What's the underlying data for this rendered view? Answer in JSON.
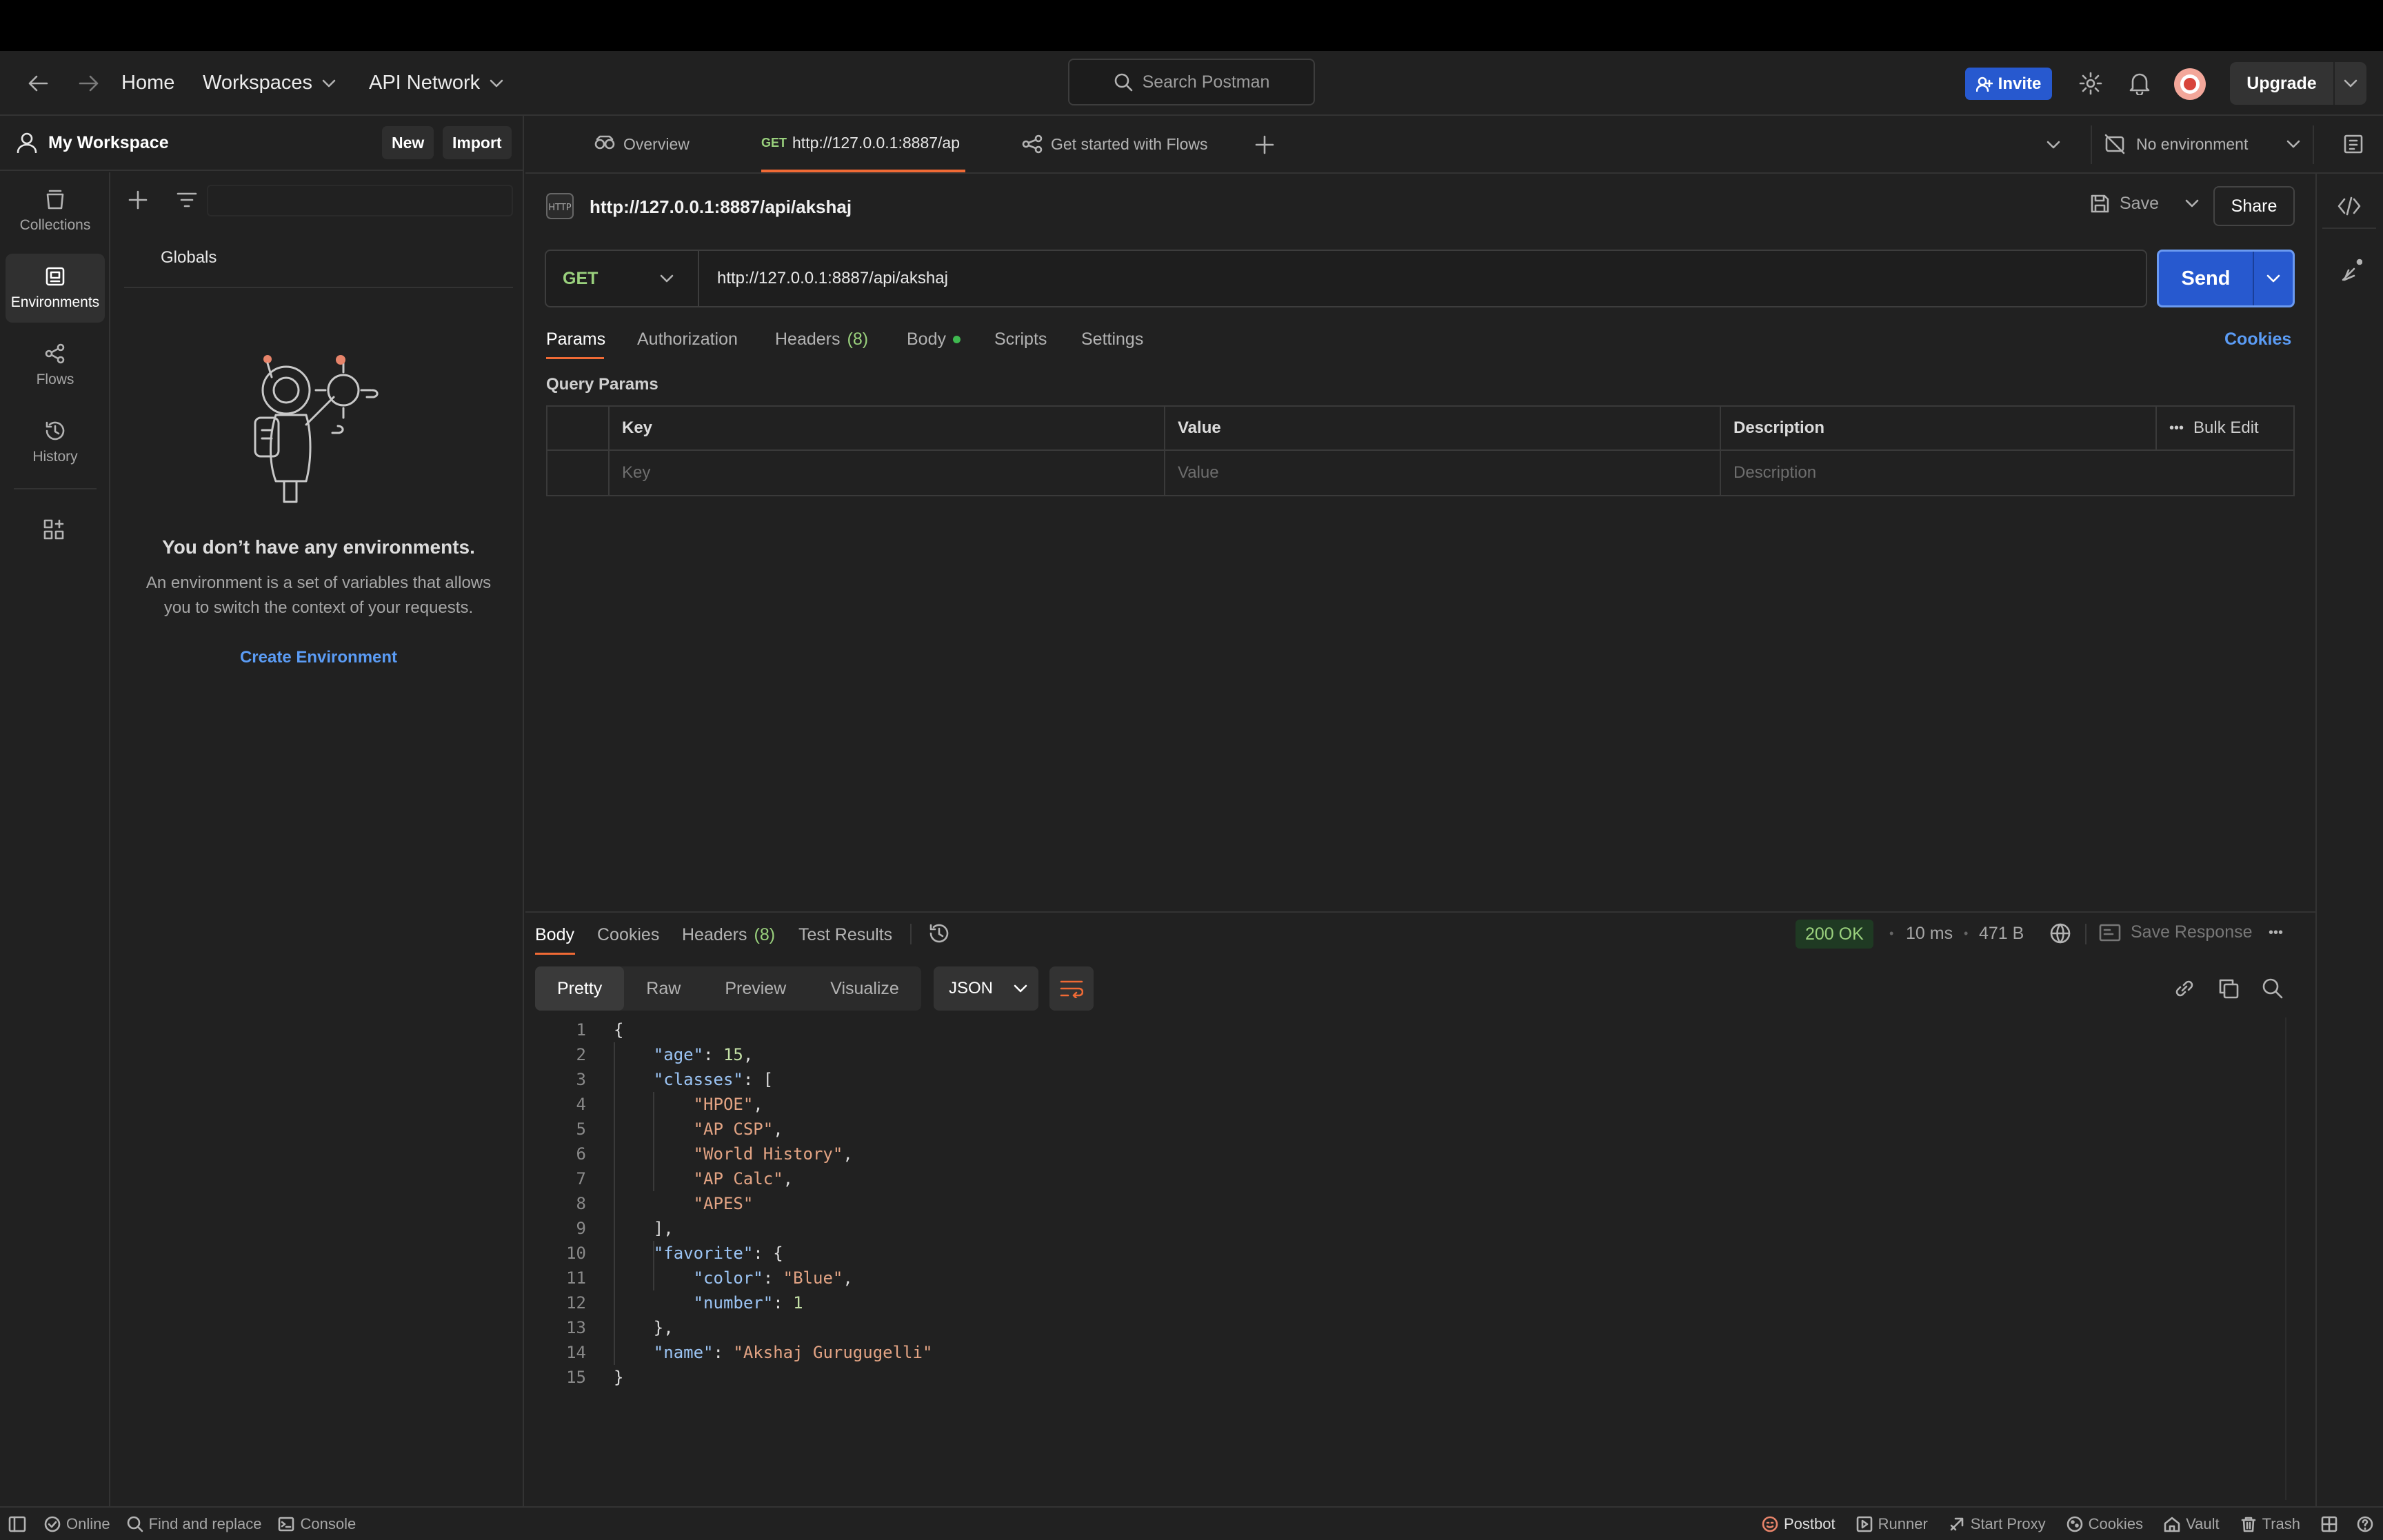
{
  "header": {
    "nav_home": "Home",
    "nav_workspaces": "Workspaces",
    "nav_api_network": "API Network",
    "search_placeholder": "Search Postman",
    "invite_label": "Invite",
    "upgrade_label": "Upgrade"
  },
  "sidebar": {
    "workspace_name": "My Workspace",
    "new_label": "New",
    "import_label": "Import",
    "rail": [
      {
        "label": "Collections",
        "icon": "collections-icon"
      },
      {
        "label": "Environments",
        "icon": "environments-icon"
      },
      {
        "label": "Flows",
        "icon": "flows-icon"
      },
      {
        "label": "History",
        "icon": "history-icon"
      }
    ],
    "globals_label": "Globals",
    "empty_title": "You don’t have any environments.",
    "empty_text_1": "An environment is a set of variables that allows",
    "empty_text_2": "you to switch the context of your requests.",
    "create_link": "Create Environment"
  },
  "tabs": {
    "overview": "Overview",
    "request_method": "GET",
    "request_url": "http://127.0.0.1:8887/ap",
    "flows": "Get started with Flows",
    "environment": "No environment"
  },
  "request": {
    "title": "http://127.0.0.1:8887/api/akshaj",
    "save_label": "Save",
    "share_label": "Share",
    "method": "GET",
    "url": "http://127.0.0.1:8887/api/akshaj",
    "send_label": "Send",
    "subtabs": {
      "params": "Params",
      "authorization": "Authorization",
      "headers": "Headers",
      "headers_count": "(8)",
      "body": "Body",
      "scripts": "Scripts",
      "settings": "Settings"
    },
    "cookies_link": "Cookies",
    "query_params_title": "Query Params",
    "columns": {
      "key": "Key",
      "value": "Value",
      "description": "Description",
      "bulk_edit": "Bulk Edit"
    },
    "placeholders": {
      "key": "Key",
      "value": "Value",
      "description": "Description"
    }
  },
  "response": {
    "tabs": {
      "body": "Body",
      "cookies": "Cookies",
      "headers": "Headers",
      "headers_count": "(8)",
      "test_results": "Test Results"
    },
    "status": "200 OK",
    "time": "10 ms",
    "size": "471 B",
    "save_response": "Save Response",
    "view_modes": [
      "Pretty",
      "Raw",
      "Preview",
      "Visualize"
    ],
    "format": "JSON",
    "line_numbers": [
      "1",
      "2",
      "3",
      "4",
      "5",
      "6",
      "7",
      "8",
      "9",
      "10",
      "11",
      "12",
      "13",
      "14",
      "15"
    ],
    "code": {
      "l1": "{",
      "age_key": "\"age\"",
      "age_val": "15",
      "classes_key": "\"classes\"",
      "c1": "\"HPOE\"",
      "c2": "\"AP CSP\"",
      "c3": "\"World History\"",
      "c4": "\"AP Calc\"",
      "c5": "\"APES\"",
      "fav_key": "\"favorite\"",
      "color_key": "\"color\"",
      "color_val": "\"Blue\"",
      "number_key": "\"number\"",
      "number_val": "1",
      "name_key": "\"name\"",
      "name_val": "\"Akshaj Gurugugelli\""
    }
  },
  "statusbar": {
    "online": "Online",
    "find_replace": "Find and replace",
    "console": "Console",
    "postbot": "Postbot",
    "runner": "Runner",
    "start_proxy": "Start Proxy",
    "cookies": "Cookies",
    "vault": "Vault",
    "trash": "Trash"
  },
  "colors": {
    "accent_blue": "#2759cf",
    "link_blue": "#5b9cf5",
    "status_green": "#9ad17d",
    "unsaved_dot": "#f06a35"
  }
}
